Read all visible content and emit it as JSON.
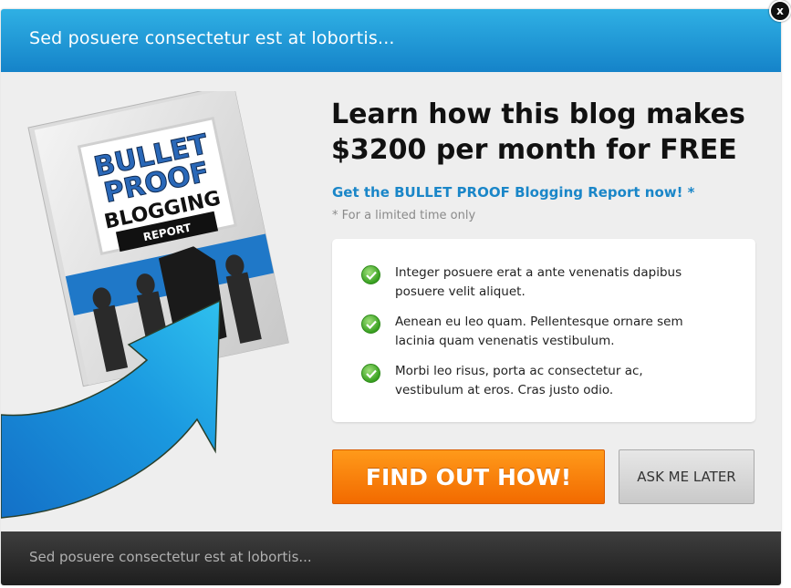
{
  "header": {
    "title": "Sed posuere consectetur est at lobortis..."
  },
  "close_button": {
    "label": "x"
  },
  "product": {
    "cover_line1": "BULLET",
    "cover_line2": "PROOF",
    "cover_line3": "BLOGGING",
    "cover_banner": "REPORT"
  },
  "main": {
    "headline_line1": "Learn how this blog makes",
    "headline_line2": "$3200 per month for FREE",
    "subhead": "Get the BULLET PROOF Blogging Report now! *",
    "note": "* For a limited time only",
    "bullets": [
      {
        "line1": "Integer posuere erat a ante venenatis dapibus",
        "line2": "posuere velit aliquet."
      },
      {
        "line1": "Aenean eu leo quam. Pellentesque ornare sem",
        "line2": "lacinia quam venenatis vestibulum."
      },
      {
        "line1": "Morbi leo risus, porta ac consectetur ac,",
        "line2": "vestibulum at eros. Cras justo odio."
      }
    ]
  },
  "actions": {
    "primary_label": "FIND OUT HOW!",
    "secondary_label": "ASK ME LATER"
  },
  "footer": {
    "text": "Sed posuere consectetur est at lobortis..."
  },
  "colors": {
    "header_blue": "#1583c9",
    "accent_blue": "#1a86c8",
    "cta_orange": "#f26a00",
    "footer_dark": "#1e1e1e",
    "check_green": "#38a020"
  },
  "icons": [
    "close-icon",
    "check-icon",
    "arrow-graphic",
    "ebook-cover"
  ]
}
